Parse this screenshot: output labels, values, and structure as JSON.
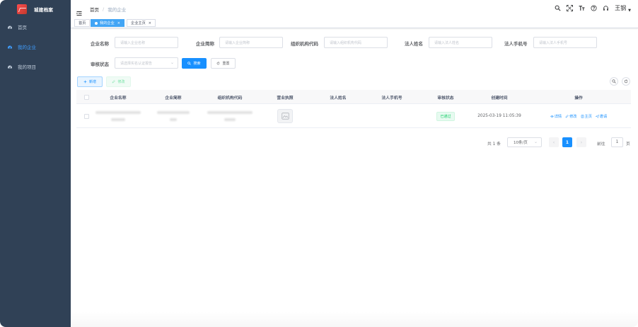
{
  "app": {
    "title": "城建档案"
  },
  "sidebar": {
    "items": [
      {
        "label": "首页",
        "icon": "dashboard-icon",
        "active": false
      },
      {
        "label": "我的企业",
        "icon": "dashboard-icon",
        "active": true
      },
      {
        "label": "我的项目",
        "icon": "dashboard-icon",
        "active": false
      }
    ]
  },
  "navbar": {
    "breadcrumb": [
      "首页",
      "/",
      "我的企业"
    ],
    "username": "王钢",
    "icons": [
      "search-icon",
      "fullscreen-icon",
      "font-size-icon",
      "help-icon",
      "headset-icon"
    ]
  },
  "tags": [
    {
      "label": "首页",
      "active": false
    },
    {
      "label": "我的企业",
      "active": true,
      "close": "×"
    },
    {
      "label": "企业主页",
      "active": false,
      "close": "×"
    }
  ],
  "search": {
    "company_name_label": "企业名称",
    "company_name_placeholder": "请输入企业名称",
    "short_name_label": "企业简称",
    "short_name_placeholder": "请输入企业简称",
    "org_code_label": "组织机构代码",
    "org_code_placeholder": "请输入组织机构代码",
    "legal_name_label": "法人姓名",
    "legal_name_placeholder": "请输入法人姓名",
    "legal_phone_label": "法人手机号",
    "legal_phone_placeholder": "请输入法人手机号",
    "status_label": "审核状态",
    "status_placeholder": "请选择实名认证报告",
    "search_button": "搜索",
    "reset_button": "重置"
  },
  "toolbar": {
    "add_button": "新增",
    "edit_button": "修改"
  },
  "table": {
    "columns": [
      "企业名称",
      "企业简称",
      "组织机构代码",
      "营业执照",
      "法人姓名",
      "法人手机号",
      "审核状态",
      "创建时间",
      "操作"
    ],
    "rows": [
      {
        "status": "已通过",
        "created": "2025-03-19 11:05:39",
        "ops": [
          "详情",
          "修改",
          "主页",
          "邀请"
        ]
      }
    ]
  },
  "pagination": {
    "total": "共 1 条",
    "page_size": "10条/页",
    "prev": "‹",
    "current": "1",
    "next": "›",
    "goto_label": "前往",
    "goto_value": "1",
    "goto_suffix": "页"
  },
  "colors": {
    "sidebar_bg": "#304156",
    "primary": "#1890ff",
    "success": "#13ce66"
  }
}
